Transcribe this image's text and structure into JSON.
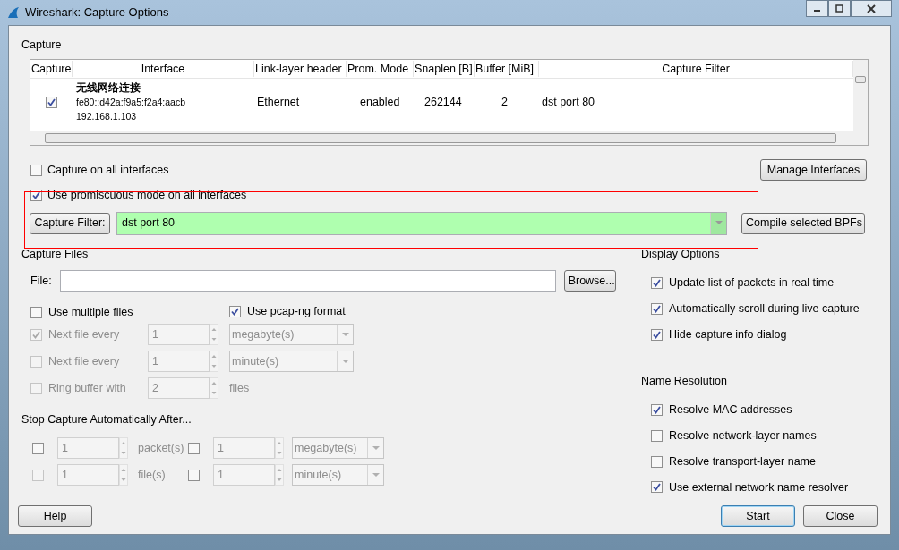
{
  "window": {
    "title": "Wireshark: Capture Options"
  },
  "capture": {
    "title": "Capture",
    "columns": [
      "Capture",
      "Interface",
      "Link-layer header",
      "Prom. Mode",
      "Snaplen [B]",
      "Buffer [MiB]",
      "Capture Filter"
    ],
    "rows": [
      {
        "checked": true,
        "name": "无线网络连接",
        "address": "fe80::d42a:f9a5:f2a4:aacb",
        "ip": "192.168.1.103",
        "link_layer": "Ethernet",
        "prom_mode": "enabled",
        "snaplen": "262144",
        "buffer": "2",
        "filter": "dst port 80"
      }
    ],
    "options": [
      {
        "label": "Capture on all interfaces",
        "checked": false
      },
      {
        "label": "Use promiscuous mode on all interfaces",
        "checked": true
      }
    ],
    "manage_button": "Manage Interfaces",
    "filter_button": "Capture Filter:",
    "filter_value": "dst port 80",
    "filter_valid": true,
    "compile_button": "Compile selected BPFs",
    "highlighted": true
  },
  "capture_files": {
    "title": "Capture Files",
    "file_label": "File:",
    "browse_button": "Browse...",
    "options": [
      {
        "label": "Use multiple files",
        "checked": false
      },
      {
        "label": "Use pcap-ng format",
        "checked": true
      }
    ],
    "rotation": [
      {
        "label": "Next file every",
        "checked": true,
        "value": "1",
        "kind": "select",
        "unit": "megabyte(s)"
      },
      {
        "label": "Next file every",
        "checked": false,
        "value": "1",
        "kind": "select",
        "unit": "minute(s)"
      },
      {
        "label": "Ring buffer with",
        "checked": false,
        "value": "2",
        "kind": "text",
        "unit": "files"
      }
    ]
  },
  "stop_capture": {
    "title": "Stop Capture Automatically After...",
    "rows": [
      {
        "checked": false,
        "disabled": false,
        "value": "1",
        "unit": "packet(s)",
        "second_checked": false,
        "second_value": "1",
        "second_unit": "megabyte(s)"
      },
      {
        "checked": false,
        "disabled": true,
        "value": "1",
        "unit": "file(s)",
        "second_checked": false,
        "second_value": "1",
        "second_unit": "minute(s)"
      }
    ]
  },
  "display_options": {
    "title": "Display Options",
    "items": [
      {
        "label": "Update list of packets in real time",
        "checked": true
      },
      {
        "label": "Automatically scroll during live capture",
        "checked": true
      },
      {
        "label": "Hide capture info dialog",
        "checked": true
      }
    ]
  },
  "name_resolution": {
    "title": "Name Resolution",
    "items": [
      {
        "label": "Resolve MAC addresses",
        "checked": true
      },
      {
        "label": "Resolve network-layer names",
        "checked": false
      },
      {
        "label": "Resolve transport-layer name",
        "checked": false
      },
      {
        "label": "Use external network name resolver",
        "checked": true
      }
    ]
  },
  "buttons": [
    {
      "label": "Help",
      "default": false
    },
    {
      "label": "Start",
      "default": true
    },
    {
      "label": "Close",
      "default": false
    }
  ]
}
